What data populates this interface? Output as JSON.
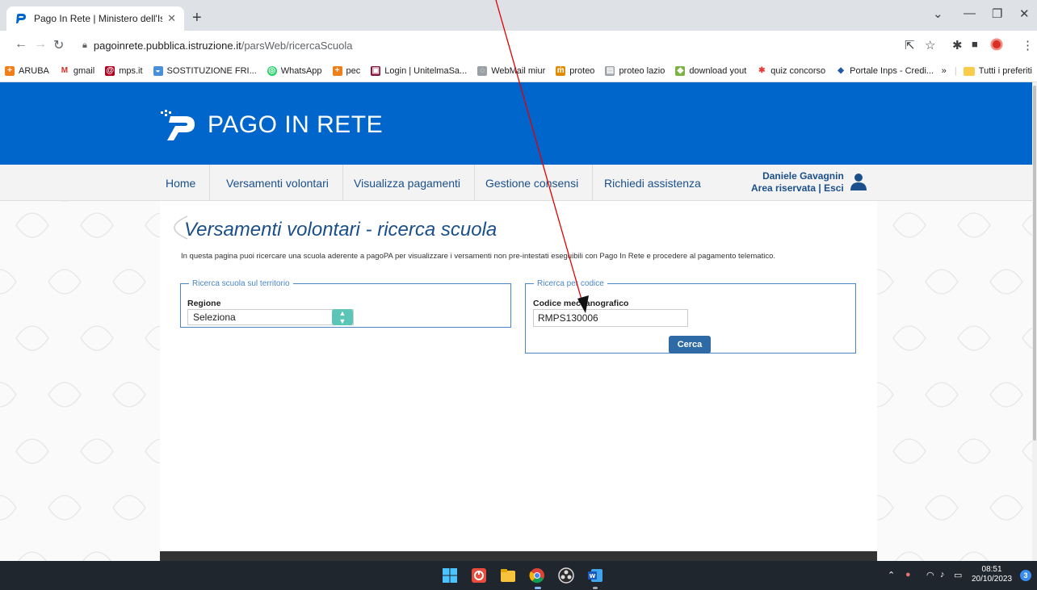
{
  "browser": {
    "tab_title": "Pago In Rete | Ministero dell'Istr",
    "url_host": "pagoinrete.pubblica.istruzione.it",
    "url_path": "/parsWeb/ricercaScuola",
    "bookmarks": [
      {
        "label": "ARUBA",
        "color": "#f07f1a",
        "glyph": "+"
      },
      {
        "label": "gmail",
        "color": "#d93025",
        "glyph": "M"
      },
      {
        "label": "mps.it",
        "color": "#b00020",
        "glyph": "@"
      },
      {
        "label": "SOSTITUZIONE FRI...",
        "color": "#4a90d9",
        "glyph": "◒"
      },
      {
        "label": "WhatsApp",
        "color": "#25d366",
        "glyph": "◎"
      },
      {
        "label": "pec",
        "color": "#f07f1a",
        "glyph": "+"
      },
      {
        "label": "Login | UnitelmaSa...",
        "color": "#8a1538",
        "glyph": "▣"
      },
      {
        "label": "WebMail miur",
        "color": "#9aa0a6",
        "glyph": "◌"
      },
      {
        "label": "proteo",
        "color": "#e08a00",
        "glyph": "ṁ"
      },
      {
        "label": "proteo lazio",
        "color": "#9aa0a6",
        "glyph": "▤"
      },
      {
        "label": "download yout",
        "color": "#7cb342",
        "glyph": "◆"
      },
      {
        "label": "quiz concorso",
        "color": "#e53935",
        "glyph": "✱"
      },
      {
        "label": "Portale Inps - Credi...",
        "color": "#1e5aa8",
        "glyph": "◆"
      }
    ],
    "bookmarks_more": "»",
    "all_bookmarks": "Tutti i preferiti"
  },
  "site": {
    "logo_text": "PAGO IN RETE",
    "nav": [
      "Home",
      "Versamenti volontari",
      "Visualizza pagamenti",
      "Gestione consensi",
      "Richiedi assistenza"
    ],
    "user_name": "Daniele Gavagnin",
    "user_links": "Area riservata | Esci",
    "page_title": "Versamenti volontari - ricerca scuola",
    "intro": "In questa pagina puoi ricercare una scuola aderente a pagoPA per visualizzare i versamenti non pre-intestati eseguibili con Pago In Rete e procedere al pagamento telematico.",
    "territory": {
      "legend": "Ricerca scuola sul territorio",
      "region_label": "Regione",
      "region_value": "Seleziona"
    },
    "code_search": {
      "legend": "Ricerca per codice",
      "code_label": "Codice meccanografico",
      "code_value": "RMPS130006",
      "search_button": "Cerca"
    }
  },
  "taskbar": {
    "time": "08:51",
    "date": "20/10/2023",
    "notifications": "3"
  }
}
